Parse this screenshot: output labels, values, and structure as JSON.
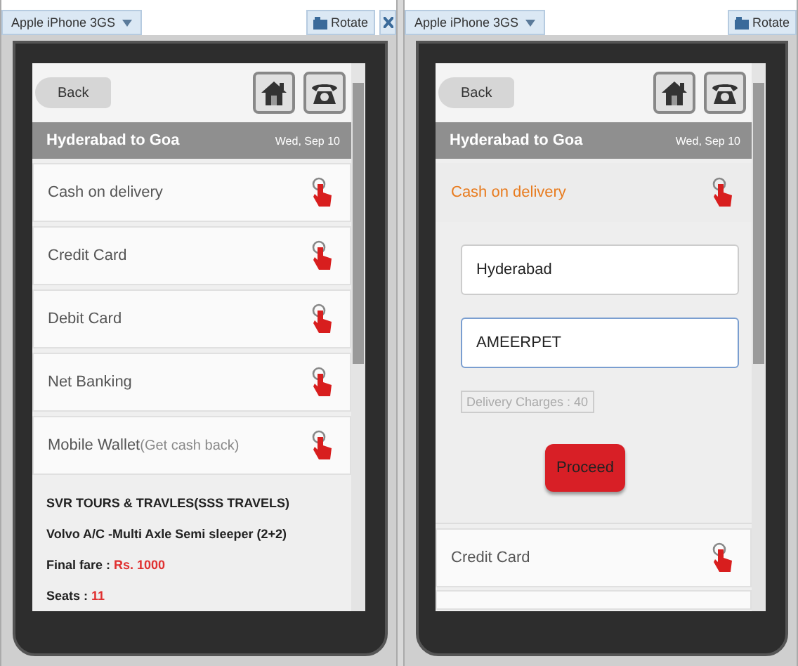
{
  "panels": [
    {
      "device": "Apple iPhone 3GS",
      "toolbar_buttons": [
        {
          "kind": "rotate",
          "label": "Rotate"
        },
        {
          "kind": "close"
        }
      ],
      "back": "Back",
      "title": "Hyderabad to Goa",
      "date": "Wed, Sep 10",
      "options": [
        {
          "label": "Cash on delivery",
          "expanded": false
        },
        {
          "label": "Credit Card",
          "expanded": false
        },
        {
          "label": "Debit Card",
          "expanded": false
        },
        {
          "label": "Net Banking",
          "expanded": false
        },
        {
          "label": "Mobile Wallet",
          "note": "(Get cash back)",
          "expanded": false
        }
      ],
      "bus": {
        "operator": "SVR TOURS & TRAVLES(SSS TRAVELS)",
        "type": "Volvo A/C -Multi Axle Semi sleeper (2+2)",
        "fare_label": "Final fare :",
        "fare": "Rs. 1000",
        "seats_label": "Seats :",
        "seats": "11"
      }
    },
    {
      "device": "Apple iPhone 3GS",
      "toolbar_buttons": [
        {
          "kind": "rotate",
          "label": "Rotate"
        }
      ],
      "back": "Back",
      "title": "Hyderabad to Goa",
      "date": "Wed, Sep 10",
      "options": [
        {
          "label": "Cash on delivery",
          "expanded": true,
          "city": "Hyderabad",
          "area": "AMEERPET",
          "charges": "Delivery Charges : 40",
          "proceed": "Proceed"
        },
        {
          "label": "Credit Card",
          "expanded": false
        },
        {
          "kind": "partial",
          "expanded": false
        }
      ]
    }
  ]
}
